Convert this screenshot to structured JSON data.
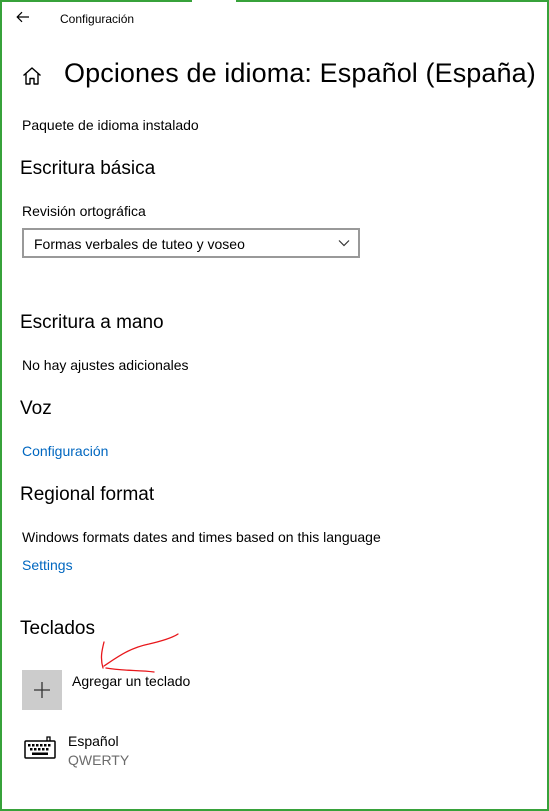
{
  "window": {
    "title": "Configuración",
    "accent_color": "#37a23a"
  },
  "header": {
    "back_icon": "arrow-left-icon",
    "home_icon": "home-icon",
    "page_title": "Opciones de idioma: Español (España)"
  },
  "language_pack": {
    "status": "Paquete de idioma instalado"
  },
  "basic_typing": {
    "heading": "Escritura básica",
    "spellcheck_label": "Revisión ortográfica",
    "spellcheck_value": "Formas verbales de tuteo y voseo"
  },
  "handwriting": {
    "heading": "Escritura a mano",
    "note": "No hay ajustes adicionales"
  },
  "speech": {
    "heading": "Voz",
    "settings_link": "Configuración"
  },
  "regional_format": {
    "heading": "Regional format",
    "description": "Windows formats dates and times based on this language",
    "settings_link": "Settings"
  },
  "keyboards": {
    "heading": "Teclados",
    "add_label": "Agregar un teclado",
    "add_icon": "plus-icon",
    "items": [
      {
        "name": "Español",
        "layout": "QWERTY",
        "icon": "keyboard-icon"
      }
    ]
  },
  "colors": {
    "link": "#0067c0",
    "annotation": "#e8171b"
  }
}
